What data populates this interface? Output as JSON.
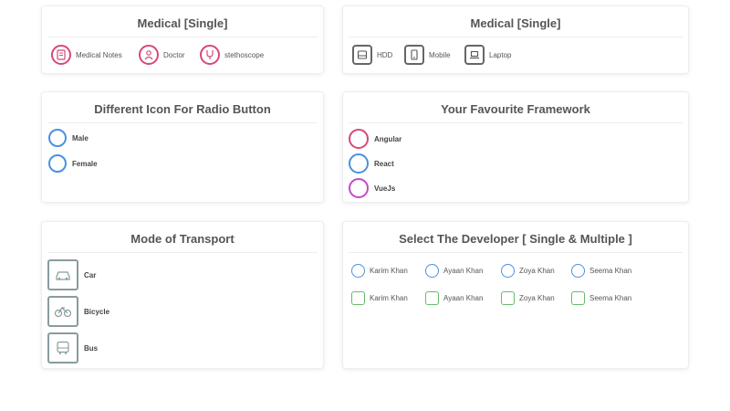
{
  "colors": {
    "medical": "#d7487a",
    "blue": "#4a90e2",
    "purple": "#c34ac8",
    "green": "#66bb6a",
    "device": "#555555",
    "transport": "#8a9ba0"
  },
  "card1": {
    "title": "Medical [Single]",
    "items": [
      {
        "icon": "medical-notes-icon",
        "label": "Medical Notes"
      },
      {
        "icon": "doctor-icon",
        "label": "Doctor"
      },
      {
        "icon": "stethoscope-icon",
        "label": "stethoscope"
      }
    ]
  },
  "card2": {
    "title": "Medical [Single]",
    "items": [
      {
        "icon": "hdd-icon",
        "label": "HDD"
      },
      {
        "icon": "mobile-icon",
        "label": "Mobile"
      },
      {
        "icon": "laptop-icon",
        "label": "Laptop"
      }
    ]
  },
  "card3": {
    "title": "Different Icon For Radio Button",
    "items": [
      {
        "label": "Male"
      },
      {
        "label": "Female"
      }
    ]
  },
  "card4": {
    "title": "Your Favourite Framework",
    "items": [
      {
        "label": "Angular"
      },
      {
        "label": "React"
      },
      {
        "label": "VueJs"
      }
    ]
  },
  "card5": {
    "title": "Mode of Transport",
    "items": [
      {
        "icon": "car-icon",
        "label": "Car"
      },
      {
        "icon": "bicycle-icon",
        "label": "Bicycle"
      },
      {
        "icon": "bus-icon",
        "label": "Bus"
      }
    ]
  },
  "card6": {
    "title": "Select The Developer [ Single & Multiple ]",
    "radios": [
      {
        "label": "Karim Khan"
      },
      {
        "label": "Ayaan Khan"
      },
      {
        "label": "Zoya Khan"
      },
      {
        "label": "Seema Khan"
      }
    ],
    "checkboxes": [
      {
        "label": "Karim Khan"
      },
      {
        "label": "Ayaan Khan"
      },
      {
        "label": "Zoya Khan"
      },
      {
        "label": "Seema Khan"
      }
    ]
  }
}
